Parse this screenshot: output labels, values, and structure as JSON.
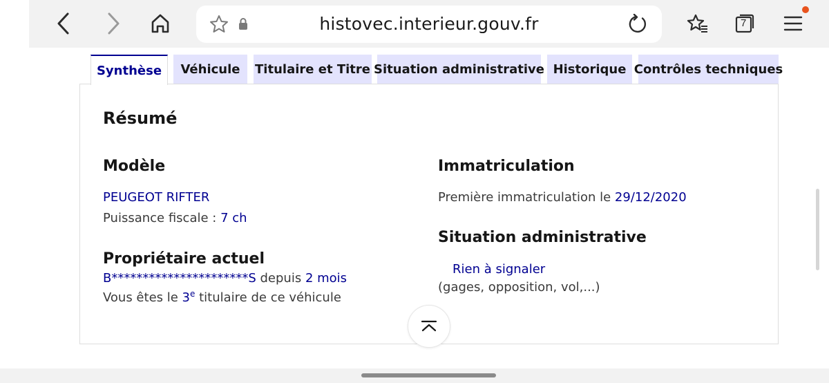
{
  "browser": {
    "url": "histovec.interieur.gouv.fr",
    "tab_count": "7"
  },
  "tabs": [
    {
      "label": "Synthèse",
      "active": true
    },
    {
      "label": "Véhicule"
    },
    {
      "label": "Titulaire et Titre"
    },
    {
      "label": "Situation administrative"
    },
    {
      "label": "Historique"
    },
    {
      "label": "Contrôles techniques"
    }
  ],
  "summary": {
    "heading": "Résumé",
    "model": {
      "heading": "Modèle",
      "name": "PEUGEOT RIFTER",
      "fiscal_label": "Puissance fiscale : ",
      "fiscal_value": "7 ch"
    },
    "owner": {
      "heading": "Propriétaire actuel",
      "masked_name": "B**********************S",
      "since_label": " depuis ",
      "since_value": "2 mois",
      "rank_prefix": "Vous êtes le ",
      "rank_number": "3",
      "rank_sup": "e",
      "rank_suffix": " titulaire de ce véhicule"
    },
    "registration": {
      "heading": "Immatriculation",
      "label": "Première immatriculation le ",
      "date": "29/12/2020"
    },
    "admin": {
      "heading": "Situation administrative",
      "status": "Rien à signaler",
      "details": "(gages, opposition, vol,...)"
    }
  },
  "colors": {
    "accent": "#000091",
    "tab_bg": "#e3e3fd",
    "notification": "#e8531d"
  }
}
